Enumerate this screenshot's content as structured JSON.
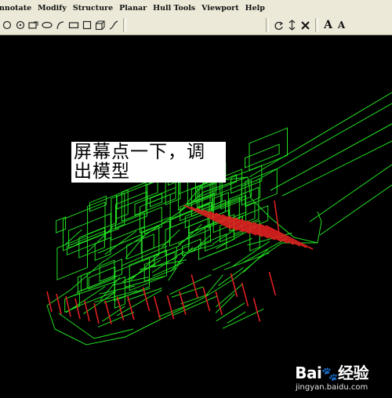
{
  "menubar": {
    "items": [
      "nnotate",
      "Modify",
      "Structure",
      "Planar",
      "Hull Tools",
      "Viewport",
      "Help"
    ]
  },
  "toolbar": {
    "icons": [
      "circle-icon",
      "dot-circle-icon",
      "rectangle-check-icon",
      "ellipse-icon",
      "arc-icon",
      "rectangle-icon",
      "square-icon",
      "cube-icon",
      "curve-icon",
      "rotate-icon",
      "arrows-icon",
      "close-x-icon"
    ],
    "text_a1": "A",
    "text_a2": "A"
  },
  "annotation": {
    "line1": "屏幕点一下，调",
    "line2": "出模型"
  },
  "watermark": {
    "logo_a": "Bai",
    "logo_b": "经验",
    "url": "jingyan.baidu.com"
  },
  "colors": {
    "ui_gray": "#ece9d8",
    "model_green": "#22e022",
    "model_red": "#e02020",
    "background": "#000000"
  }
}
